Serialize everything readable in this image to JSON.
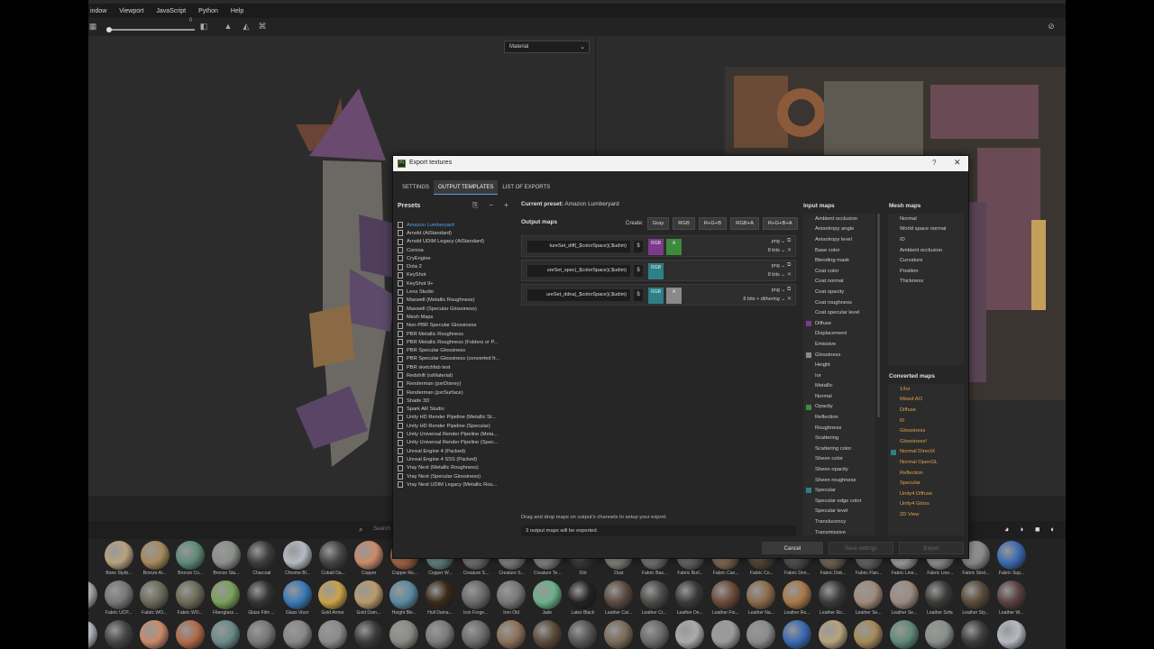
{
  "menu": [
    "indow",
    "Viewport",
    "JavaScript",
    "Python",
    "Help"
  ],
  "toolbar": {
    "slider_value": "0"
  },
  "viewport": {
    "material_select": "Material"
  },
  "dialog": {
    "title": "Export textures",
    "help": "?",
    "close": "✕",
    "tabs": [
      "SETTINGS",
      "OUTPUT TEMPLATES",
      "LIST OF EXPORTS"
    ],
    "presets_label": "Presets",
    "presets": [
      "Amazon Lumberyard",
      "Arnold (AiStandard)",
      "Arnold UDIM Legacy (AiStandard)",
      "Corona",
      "CryEngine",
      "Dota 2",
      "KeyShot",
      "KeyShot 9+",
      "Lens Studio",
      "Maxwell (Metallic Roughness)",
      "Maxwell (Specular Glossiness)",
      "Mesh Maps",
      "Non-PBR Specular Glossiness",
      "PBR Metallic Roughness",
      "PBR Metallic Roughness (Folders or P...",
      "PBR Specular Glossiness",
      "PBR Specular Glossiness (converted fr...",
      "PBR sketchfab test",
      "Redshift (rsMaterial)",
      "Renderman (pxrDisney)",
      "Renderman (pxrSurface)",
      "Shade 3D",
      "Spark AR Studio",
      "Unity HD Render Pipeline (Metallic St...",
      "Unity HD Render Pipeline (Specular)",
      "Unity Universal Render Pipeline (Meta...",
      "Unity Universal Render Pipeline (Spec...",
      "Unreal Engine 4 (Packed)",
      "Unreal Engine 4 SSS (Packed)",
      "Vray Next (Metallic Roughness)",
      "Vray Next (Specular Glossiness)",
      "Vray Next UDIM Legacy (Metallic Rou..."
    ],
    "current_preset_label": "Current preset:",
    "current_preset": "Amazon Lumberyard",
    "output_maps_label": "Output maps",
    "create_label": "Create:",
    "create_buttons": [
      "Gray",
      "RGB",
      "R+G+B",
      "RGB+A",
      "R+G+B+A"
    ],
    "output_rows": [
      {
        "name": "tureSet_diff(_$colorSpace)(.$udim)",
        "dollar": "$",
        "channels": [
          "RGB",
          "A"
        ],
        "format": "png",
        "bits": "8 bits"
      },
      {
        "name": "ureSet_spec(_$colorSpace)(.$udim)",
        "dollar": "$",
        "channels": [
          "RGB"
        ],
        "format": "png",
        "bits": "8 bits"
      },
      {
        "name": "ureSet_ddna(_$colorSpace)(.$udim)",
        "dollar": "$",
        "channels": [
          "RGB",
          "A"
        ],
        "format": "png",
        "bits": "8 bits + dithering"
      }
    ],
    "hint": "Drag and drop maps on output's channels to setup your export.",
    "status": "3 output maps will be exported.",
    "input_maps_label": "Input maps",
    "input_maps": [
      "Ambient occlusion",
      "Anisotropy angle",
      "Anisotropy level",
      "Base color",
      "Blending mask",
      "Coat color",
      "Coat normal",
      "Coat opacity",
      "Coat roughness",
      "Coat specular level",
      "Diffuse",
      "Displacement",
      "Emissive",
      "Glossiness",
      "Height",
      "Ior",
      "Metallic",
      "Normal",
      "Opacity",
      "Reflection",
      "Roughness",
      "Scattering",
      "Scattering color",
      "Sheen color",
      "Sheen opacity",
      "Sheen roughness",
      "Specular",
      "Specular edge color",
      "Specular level",
      "Translucency",
      "Transmissive"
    ],
    "mesh_maps_label": "Mesh maps",
    "mesh_maps": [
      "Normal",
      "World space normal",
      "ID",
      "Ambient occlusion",
      "Curvature",
      "Position",
      "Thickness"
    ],
    "converted_maps_label": "Converted maps",
    "converted_maps": [
      "1/Ior",
      "Mixed AO",
      "Diffuse",
      "f0",
      "Glossiness",
      "Glossiness²",
      "Normal DirectX",
      "Normal OpenGL",
      "Reflection",
      "Specular",
      "Unity4 Diffuse",
      "Unity4 Gloss",
      "2D View"
    ],
    "buttons": {
      "cancel": "Cancel",
      "save": "Save settings",
      "export": "Export"
    }
  },
  "shelf": {
    "search_placeholder": "Search",
    "row1_labels": [
      "Bone Styliz...",
      "Bronze Ar...",
      "Bronze Co...",
      "Bronze Sta...",
      "Charcoal",
      "Chrome Bl...",
      "Cobalt Da...",
      "Copper",
      "Copper Re...",
      "Copper W...",
      "Creature S...",
      "Creature S...",
      "Creature Te...",
      "Dirt",
      "Dust",
      "Fabric Bas...",
      "Fabric Burl...",
      "Fabric Can...",
      "Fabric Co...",
      "Fabric Den...",
      "Fabric Dob...",
      "Fabric Flan...",
      "Fabric Line...",
      "Fabric Line...",
      "Fabric Stret...",
      "Fabric Sup..."
    ],
    "row2_labels": [
      "UCP...",
      "Fabric UCP...",
      "Fabric WO...",
      "Fabric WO...",
      "Fiberglass ...",
      "Glass Film ...",
      "Glass Visor",
      "Gold Armor",
      "Gold Dam...",
      "Height Ble...",
      "Hull Dama...",
      "Iron Forge...",
      "Iron Old",
      "Jade",
      "Latex Black",
      "Leather Cal...",
      "Leather Cr...",
      "Leather De...",
      "Leather Fin...",
      "Leather Na...",
      "Leather Ro...",
      "Leather Ro...",
      "Leather Se...",
      "Leather Se...",
      "Leather Sofa",
      "Leather Sty...",
      "Leather W..."
    ]
  },
  "colors": {
    "accent": "#4ea3f3",
    "orange": "#e3a04a",
    "rgb_purple": "#7c3a8c",
    "alpha_green": "#3d8a3d",
    "rgb_teal": "#2f7f86",
    "alpha_gray": "#8a8a8a"
  }
}
